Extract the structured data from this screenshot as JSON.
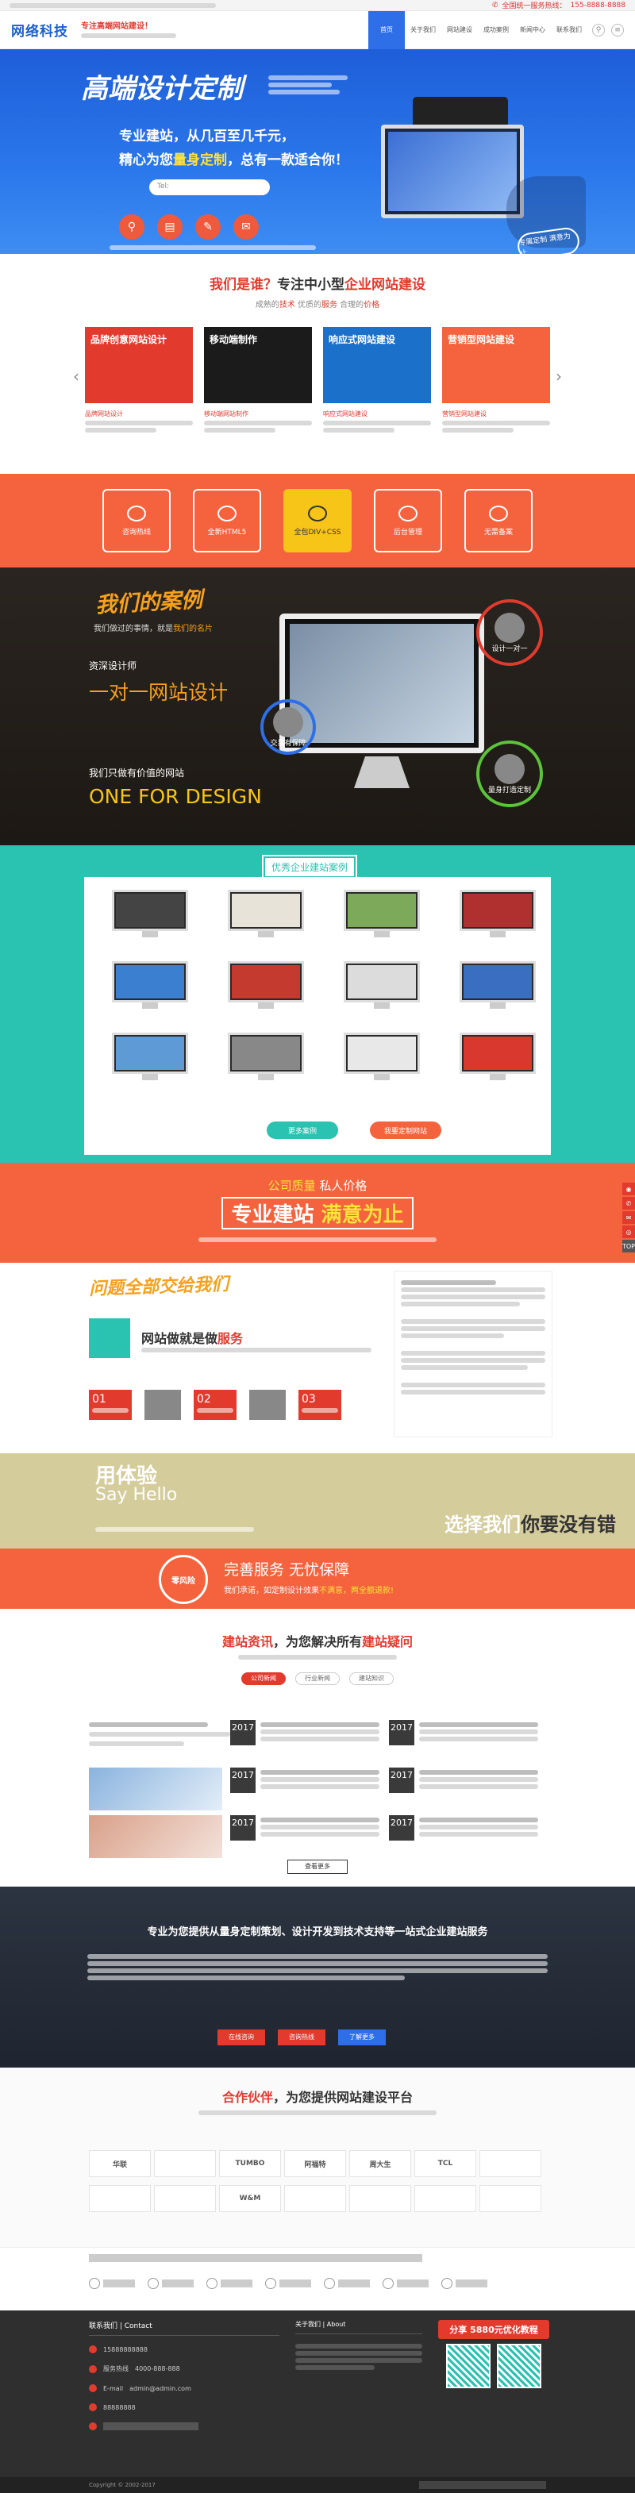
{
  "header": {
    "logo": "网络科技",
    "slogan_title": "专注高端网站建设！",
    "hotline_label": "全国统一服务热线：",
    "hotline": "155-8888-8888",
    "nav": [
      "首页",
      "关于我们",
      "网站建设",
      "成功案例",
      "新闻中心",
      "联系我们"
    ],
    "nav_active": 0,
    "colors": {
      "primary": "#2e6fe8",
      "accent": "#e23b2e",
      "orange": "#f4633e",
      "teal": "#2ac2b1",
      "gold": "#f7c518"
    }
  },
  "banner": {
    "big": "高端设计定制",
    "line1": "专业建站，从几百至几千元，",
    "line2_a": "精心为您",
    "line2_b": "量身定制",
    "line2_c": "，总有一款适合你！",
    "tel_placeholder": "Tel:",
    "circle_icons": [
      "search-icon",
      "chart-icon",
      "edit-icon",
      "mail-icon"
    ],
    "badge": "专属定制 满意为止"
  },
  "who": {
    "title_a": "我们是谁？",
    "title_b": "专注中小型",
    "title_c": "企业网站建设",
    "sub_a": "成熟的",
    "sub_b": "技术",
    "sub_c": " 优质的",
    "sub_d": "服务",
    "sub_e": " 合理的",
    "sub_f": "价格",
    "cards": [
      {
        "title": "品牌创意网站设计",
        "caption": "品牌网站设计",
        "color": "#e23b2e"
      },
      {
        "title": "移动端制作",
        "caption": "移动端网站制作",
        "color": "#1b1b1b"
      },
      {
        "title": "响应式网站建设",
        "caption": "响应式网站建设",
        "color": "#1b70c9"
      },
      {
        "title": "营销型网站建设",
        "caption": "营销型网站建设",
        "color": "#f4633e"
      }
    ]
  },
  "services": [
    {
      "label": "咨询热线",
      "icon": "clock-icon"
    },
    {
      "label": "全新HTML5",
      "icon": "globe-icon"
    },
    {
      "label": "全包DIV+CSS",
      "icon": "css-icon"
    },
    {
      "label": "后台管理",
      "icon": "monitor-icon"
    },
    {
      "label": "无需备案",
      "icon": "server-icon"
    }
  ],
  "cases": {
    "title": "我们的案例",
    "sub_a": "我们做过的事情，就是",
    "sub_b": "我们的名片",
    "desc1": "资深设计师",
    "desc2": "一对一网站设计",
    "desc3": "我们只做有价值的网站",
    "desc4": "ONE FOR DESIGN",
    "orbs": [
      "设计一对一",
      "交易有保障",
      "量身打造定制"
    ]
  },
  "good": {
    "title": "优秀企业建站案例",
    "btn1": "更多案例",
    "btn2": "我要定制网站"
  },
  "price": {
    "l1_a": "公司质量",
    "l1_b": "私人价格",
    "l2_a": "专业建站",
    "l2_b": "满意为止"
  },
  "qa": {
    "title": "问题全部交给我们",
    "h_a": "网站做就是做",
    "h_b": "服务",
    "cols": [
      {
        "n": "01"
      },
      {
        "n": "02"
      },
      {
        "n": "03"
      }
    ]
  },
  "exp": {
    "l1": "用体验",
    "l2": "Say Hello",
    "right_a": "选择我们",
    "right_b": "你要没有错"
  },
  "serve": {
    "circle": "零风险",
    "a": "完善服务 无忧保障",
    "b_a": "我们承诺，如定制设计效果",
    "b_b": "不满意，",
    "b_c": "两全额退款!"
  },
  "news": {
    "title_a": "建站资讯",
    "title_b": "，为您解决所有",
    "title_c": "建站疑问",
    "tabs": [
      "公司新闻",
      "行业新闻",
      "建站知识"
    ],
    "items": [
      {
        "day": "2017"
      },
      {
        "day": "2017"
      },
      {
        "day": "2017"
      },
      {
        "day": "2017"
      },
      {
        "day": "2017"
      },
      {
        "day": "2017"
      }
    ],
    "more": "查看更多"
  },
  "dark": {
    "heading": "专业为您提供从量身定制策划、设计开发到技术支持等一站式企业建站服务",
    "btns": [
      "在线咨询",
      "咨询热线",
      "了解更多"
    ]
  },
  "partners": {
    "title_a": "合作伙伴",
    "title_b": "，为您提供网站建设平台",
    "logos": [
      "华联",
      "",
      "TUMBO",
      "阿福特",
      "周大生",
      "TCL",
      "",
      "",
      "",
      "W&M",
      "",
      "",
      "",
      ""
    ]
  },
  "footer": {
    "contact_title": "联系我们 | Contact",
    "rows": [
      {
        "label": "",
        "value": "15888888888"
      },
      {
        "label": "服务热线",
        "value": "4000-888-888"
      },
      {
        "label": "E-mail",
        "value": "admin@admin.com"
      },
      {
        "label": "",
        "value": "88888888"
      }
    ],
    "about_title": "关于我们 | About",
    "promo_a": "分享",
    "promo_b": "5880元优化教程",
    "copyright": "Copyright © 2002-2017",
    "side_top": "TOP"
  }
}
